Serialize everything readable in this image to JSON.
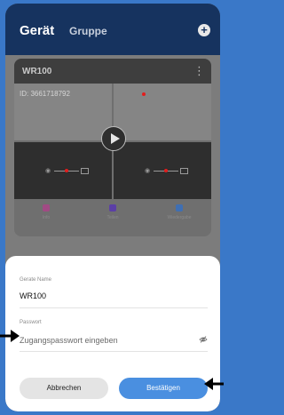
{
  "header": {
    "tab_device": "Gerät",
    "tab_group": "Gruppe",
    "add_symbol": "+"
  },
  "device_card": {
    "name": "WR100",
    "device_id": "ID: 3661718792",
    "more_symbol": "⋮",
    "actions": [
      {
        "label": "Info",
        "icon": "gift-icon",
        "color": "#a14a84"
      },
      {
        "label": "Teilen",
        "icon": "share-icon",
        "color": "#5b3fa6"
      },
      {
        "label": "Wiedergabe",
        "icon": "playback-icon",
        "color": "#3f6fb3"
      }
    ]
  },
  "dialog": {
    "name_label": "Gerate Name",
    "name_value": "WR100",
    "password_label": "Passwort",
    "password_placeholder": "Zugangspasswort eingeben",
    "cancel_label": "Abbrechen",
    "confirm_label": "Bestätigen"
  },
  "colors": {
    "background": "#3a78c8",
    "header": "#16335f",
    "confirm": "#4a8fe0",
    "status_dot": "#e21d1d"
  }
}
